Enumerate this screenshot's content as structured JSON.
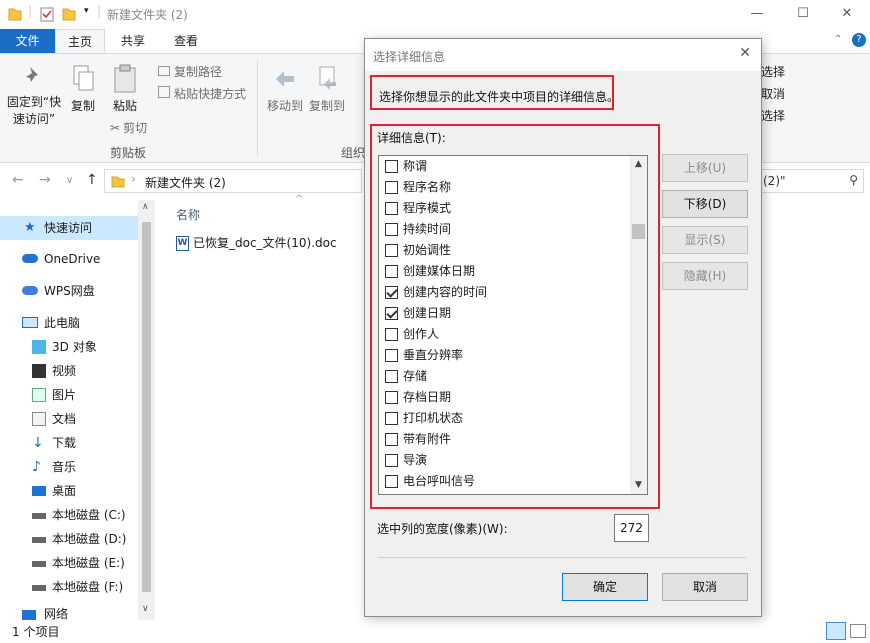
{
  "window": {
    "title": "新建文件夹 (2)",
    "controls": {
      "minimize": "—",
      "maximize": "☐",
      "close": "✕"
    }
  },
  "ribbon": {
    "tabs": [
      "文件",
      "主页",
      "共享",
      "查看"
    ],
    "home": {
      "pin_label_1": "固定到“快",
      "pin_label_2": "速访问”",
      "copy_label": "复制",
      "paste_label": "粘贴",
      "copy_path": "复制路径",
      "paste_shortcut": "粘贴快捷方式",
      "cut": "剪切",
      "clipboard_group": "剪贴板",
      "move_to": "移动到",
      "copy_to": "复制到",
      "organize_group": "组织",
      "select_all": "选择",
      "select_none": "取消",
      "invert_select": "选择"
    }
  },
  "address": {
    "path": "新建文件夹 (2)",
    "search_suffix": "(2)\""
  },
  "nav": {
    "items": [
      {
        "label": "快速访问"
      },
      {
        "label": "OneDrive"
      },
      {
        "label": "WPS网盘"
      },
      {
        "label": "此电脑"
      },
      {
        "label": "3D 对象"
      },
      {
        "label": "视频"
      },
      {
        "label": "图片"
      },
      {
        "label": "文档"
      },
      {
        "label": "下载"
      },
      {
        "label": "音乐"
      },
      {
        "label": "桌面"
      },
      {
        "label": "本地磁盘 (C:)"
      },
      {
        "label": "本地磁盘 (D:)"
      },
      {
        "label": "本地磁盘 (E:)"
      },
      {
        "label": "本地磁盘 (F:)"
      },
      {
        "label": "网络"
      }
    ]
  },
  "filelist": {
    "column_name": "名称",
    "files": [
      "已恢复_doc_文件(10).doc"
    ]
  },
  "status": {
    "count": "1 个项目"
  },
  "dialog": {
    "title": "选择详细信息",
    "description": "选择你想显示的此文件夹中项目的详细信息。",
    "list_label": "详细信息(T):",
    "items": [
      {
        "label": "称谓",
        "checked": false
      },
      {
        "label": "程序名称",
        "checked": false
      },
      {
        "label": "程序模式",
        "checked": false
      },
      {
        "label": "持续时间",
        "checked": false
      },
      {
        "label": "初始调性",
        "checked": false
      },
      {
        "label": "创建媒体日期",
        "checked": false
      },
      {
        "label": "创建内容的时间",
        "checked": true
      },
      {
        "label": "创建日期",
        "checked": true
      },
      {
        "label": "创作人",
        "checked": false
      },
      {
        "label": "垂直分辨率",
        "checked": false
      },
      {
        "label": "存储",
        "checked": false
      },
      {
        "label": "存档日期",
        "checked": false
      },
      {
        "label": "打印机状态",
        "checked": false
      },
      {
        "label": "带有附件",
        "checked": false
      },
      {
        "label": "导演",
        "checked": false
      },
      {
        "label": "电台呼叫信号",
        "checked": false
      }
    ],
    "buttons": {
      "move_up": "上移(U)",
      "move_down": "下移(D)",
      "show": "显示(S)",
      "hide": "隐藏(H)",
      "ok": "确定",
      "cancel": "取消"
    },
    "width_label": "选中列的宽度(像素)(W):",
    "width_value": "272",
    "highlight_color": "#e0232c"
  }
}
